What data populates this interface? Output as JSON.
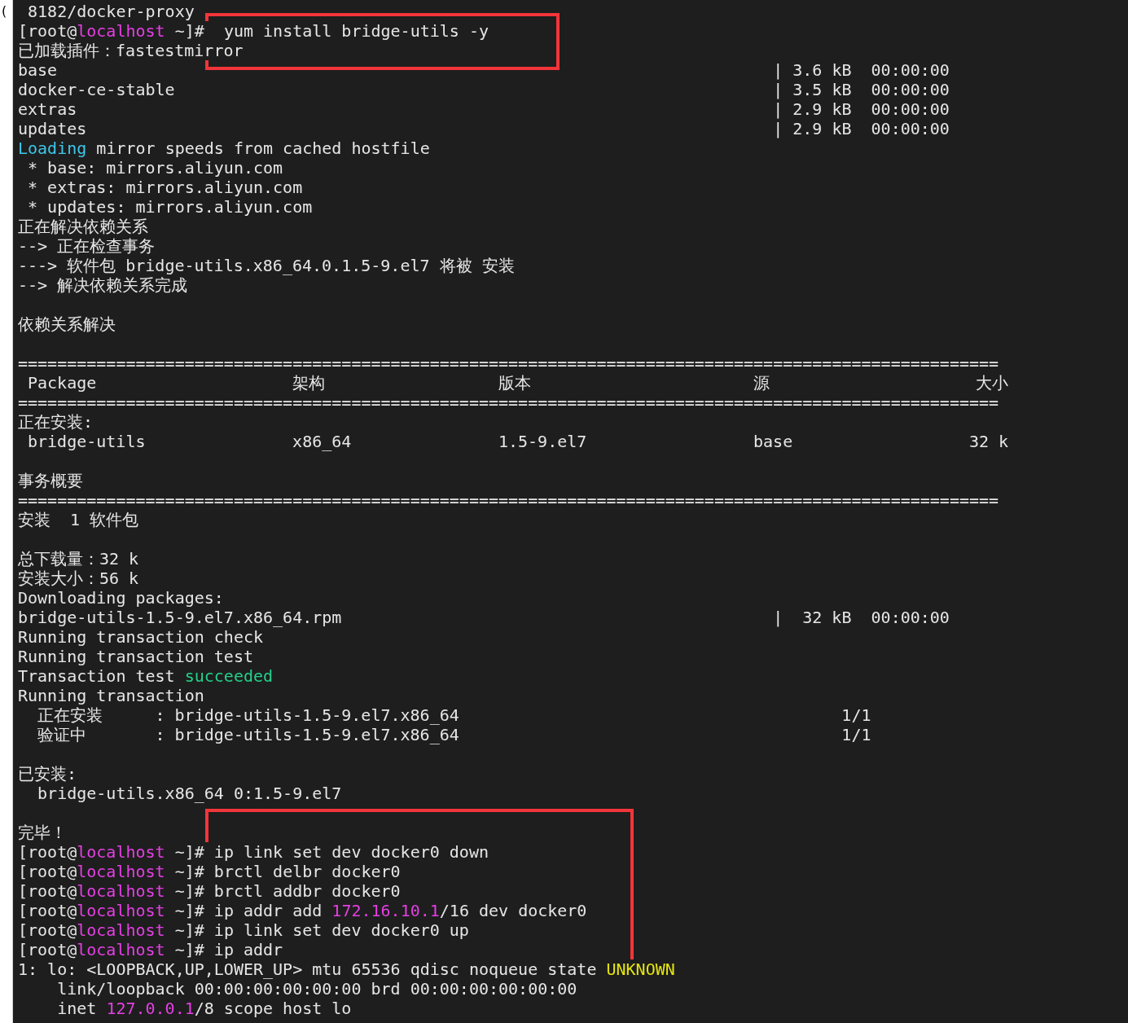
{
  "margin_text": "(",
  "blocks": [
    {
      "highlighted": false,
      "lines": [
        {
          "kind": "text",
          "spans": [
            {
              "text": " 8182/docker-proxy",
              "kind": "plain"
            }
          ]
        }
      ]
    },
    {
      "highlighted": true,
      "lines": [
        {
          "kind": "text",
          "spans": [
            {
              "text": "[root@",
              "kind": "plain"
            },
            {
              "text": "localhost",
              "kind": "host"
            },
            {
              "text": " ~]#",
              "kind": "plain"
            },
            {
              "text": "  yum install bridge-utils -y",
              "kind": "plain"
            }
          ]
        },
        {
          "kind": "text",
          "spans": [
            {
              "text": "已加载插件：fastestmirror",
              "kind": "plain"
            }
          ]
        }
      ]
    },
    {
      "highlighted": false,
      "lines": [
        {
          "kind": "repo",
          "name": "base",
          "bar": "|",
          "size": "3.6 kB",
          "time": "00:00:00"
        },
        {
          "kind": "repo",
          "name": "docker-ce-stable",
          "bar": "|",
          "size": "3.5 kB",
          "time": "00:00:00"
        },
        {
          "kind": "repo",
          "name": "extras",
          "bar": "|",
          "size": "2.9 kB",
          "time": "00:00:00"
        },
        {
          "kind": "repo",
          "name": "updates",
          "bar": "|",
          "size": "2.9 kB",
          "time": "00:00:00"
        },
        {
          "kind": "text",
          "spans": [
            {
              "text": "Loading",
              "kind": "info"
            },
            {
              "text": " mirror speeds from cached hostfile",
              "kind": "plain"
            }
          ]
        },
        {
          "kind": "text",
          "spans": [
            {
              "text": " * base: mirrors.aliyun.com",
              "kind": "plain"
            }
          ]
        },
        {
          "kind": "text",
          "spans": [
            {
              "text": " * extras: mirrors.aliyun.com",
              "kind": "plain"
            }
          ]
        },
        {
          "kind": "text",
          "spans": [
            {
              "text": " * updates: mirrors.aliyun.com",
              "kind": "plain"
            }
          ]
        },
        {
          "kind": "text",
          "spans": [
            {
              "text": "正在解决依赖关系",
              "kind": "plain"
            }
          ]
        },
        {
          "kind": "text",
          "spans": [
            {
              "text": "--> 正在检查事务",
              "kind": "plain"
            }
          ]
        },
        {
          "kind": "text",
          "spans": [
            {
              "text": "---> 软件包 bridge-utils.x86_64.0.1.5-9.el7 将被 安装",
              "kind": "plain"
            }
          ]
        },
        {
          "kind": "text",
          "spans": [
            {
              "text": "--> 解决依赖关系完成",
              "kind": "plain"
            }
          ]
        },
        {
          "kind": "blank"
        },
        {
          "kind": "text",
          "spans": [
            {
              "text": "依赖关系解决",
              "kind": "plain"
            }
          ]
        },
        {
          "kind": "blank"
        },
        {
          "kind": "rule",
          "text": "===================================================================================================="
        },
        {
          "kind": "table",
          "cells": [
            "Package",
            "架构",
            "版本",
            "源",
            "大小"
          ]
        },
        {
          "kind": "rule",
          "text": "===================================================================================================="
        },
        {
          "kind": "text",
          "spans": [
            {
              "text": "正在安装:",
              "kind": "plain"
            }
          ]
        },
        {
          "kind": "table",
          "cells": [
            "bridge-utils",
            "x86_64",
            "1.5-9.el7",
            "base",
            "32 k"
          ]
        },
        {
          "kind": "blank"
        },
        {
          "kind": "text",
          "spans": [
            {
              "text": "事务概要",
              "kind": "plain"
            }
          ]
        },
        {
          "kind": "rule",
          "text": "===================================================================================================="
        },
        {
          "kind": "text",
          "spans": [
            {
              "text": "安装  1 软件包",
              "kind": "plain"
            }
          ]
        },
        {
          "kind": "blank"
        },
        {
          "kind": "text",
          "spans": [
            {
              "text": "总下载量：32 k",
              "kind": "plain"
            }
          ]
        },
        {
          "kind": "text",
          "spans": [
            {
              "text": "安装大小：56 k",
              "kind": "plain"
            }
          ]
        },
        {
          "kind": "text",
          "spans": [
            {
              "text": "Downloading packages:",
              "kind": "plain"
            }
          ]
        },
        {
          "kind": "repo",
          "name": "bridge-utils-1.5-9.el7.x86_64.rpm",
          "bar": "|",
          "size": "32 kB",
          "time": "00:00:00"
        },
        {
          "kind": "text",
          "spans": [
            {
              "text": "Running transaction check",
              "kind": "plain"
            }
          ]
        },
        {
          "kind": "text",
          "spans": [
            {
              "text": "Running transaction test",
              "kind": "plain"
            }
          ]
        },
        {
          "kind": "text",
          "spans": [
            {
              "text": "Transaction test ",
              "kind": "plain"
            },
            {
              "text": "succeeded",
              "kind": "ok"
            }
          ]
        },
        {
          "kind": "text",
          "spans": [
            {
              "text": "Running transaction",
              "kind": "plain"
            }
          ]
        },
        {
          "kind": "progress",
          "label": "正在安装",
          "target": ": bridge-utils-1.5-9.el7.x86_64",
          "count": "1/1"
        },
        {
          "kind": "progress",
          "label": "验证中",
          "target": ": bridge-utils-1.5-9.el7.x86_64",
          "count": "1/1"
        },
        {
          "kind": "blank"
        },
        {
          "kind": "text",
          "spans": [
            {
              "text": "已安装:",
              "kind": "plain"
            }
          ]
        },
        {
          "kind": "text",
          "spans": [
            {
              "text": "  bridge-utils.x86_64 0:1.5-9.el7",
              "kind": "plain"
            }
          ]
        },
        {
          "kind": "blank"
        }
      ]
    },
    {
      "highlighted": true,
      "lines": [
        {
          "kind": "text",
          "spans": [
            {
              "text": "完毕！",
              "kind": "plain"
            }
          ]
        },
        {
          "kind": "text",
          "spans": [
            {
              "text": "[root@",
              "kind": "plain"
            },
            {
              "text": "localhost",
              "kind": "host"
            },
            {
              "text": " ~]#",
              "kind": "plain"
            },
            {
              "text": " ip link set dev docker0 down",
              "kind": "plain"
            }
          ]
        },
        {
          "kind": "text",
          "spans": [
            {
              "text": "[root@",
              "kind": "plain"
            },
            {
              "text": "localhost",
              "kind": "host"
            },
            {
              "text": " ~]#",
              "kind": "plain"
            },
            {
              "text": " brctl delbr docker0",
              "kind": "plain"
            }
          ]
        },
        {
          "kind": "text",
          "spans": [
            {
              "text": "[root@",
              "kind": "plain"
            },
            {
              "text": "localhost",
              "kind": "host"
            },
            {
              "text": " ~]#",
              "kind": "plain"
            },
            {
              "text": " brctl addbr docker0",
              "kind": "plain"
            }
          ]
        },
        {
          "kind": "text",
          "spans": [
            {
              "text": "[root@",
              "kind": "plain"
            },
            {
              "text": "localhost",
              "kind": "host"
            },
            {
              "text": " ~]#",
              "kind": "plain"
            },
            {
              "text": " ip addr add ",
              "kind": "plain"
            },
            {
              "text": "172.16.10.1",
              "kind": "ip"
            },
            {
              "text": "/16 dev docker0",
              "kind": "plain"
            }
          ]
        },
        {
          "kind": "text",
          "spans": [
            {
              "text": "[root@",
              "kind": "plain"
            },
            {
              "text": "localhost",
              "kind": "host"
            },
            {
              "text": " ~]#",
              "kind": "plain"
            },
            {
              "text": " ip link set dev docker0 up",
              "kind": "plain"
            }
          ]
        },
        {
          "kind": "text",
          "spans": [
            {
              "text": "[root@",
              "kind": "plain"
            },
            {
              "text": "localhost",
              "kind": "host"
            },
            {
              "text": " ~]#",
              "kind": "plain"
            },
            {
              "text": " ip addr",
              "kind": "plain"
            }
          ]
        }
      ]
    },
    {
      "highlighted": false,
      "lines": [
        {
          "kind": "text",
          "spans": [
            {
              "text": "1: lo: <LOOPBACK,UP,LOWER_UP> mtu 65536 qdisc noqueue state ",
              "kind": "plain"
            },
            {
              "text": "UNKNOWN",
              "kind": "warn"
            }
          ]
        },
        {
          "kind": "text",
          "spans": [
            {
              "text": "    link/loopback 00:00:00:00:00:00 brd 00:00:00:00:00:00",
              "kind": "plain"
            }
          ]
        },
        {
          "kind": "text",
          "spans": [
            {
              "text": "    inet ",
              "kind": "plain"
            },
            {
              "text": "127.0.0.1",
              "kind": "ip"
            },
            {
              "text": "/8 scope host lo",
              "kind": "plain"
            }
          ]
        }
      ]
    }
  ]
}
